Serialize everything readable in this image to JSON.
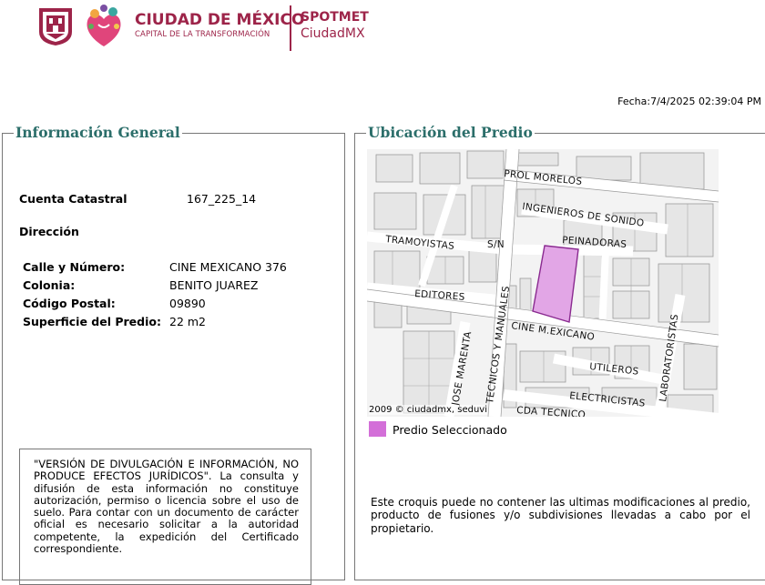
{
  "header": {
    "brand_title": "CIUDAD DE MÉXICO",
    "brand_subtitle": "CAPITAL DE LA TRANSFORMACIÓN",
    "app_line1": "SPOTMET",
    "app_line2": "CiudadMX",
    "brand_color": "#9d2449"
  },
  "fecha": "Fecha:7/4/2025 02:39:04 PM",
  "general": {
    "legend": "Información General",
    "cuenta_label": "Cuenta Catastral",
    "cuenta_value": "167_225_14",
    "direccion_label": "Dirección",
    "calle_label": "Calle y Número:",
    "calle_value": "CINE MEXICANO 376",
    "colonia_label": "Colonia:",
    "colonia_value": "BENITO JUAREZ",
    "cp_label": "Código Postal:",
    "cp_value": "09890",
    "superficie_label": "Superficie del Predio:",
    "superficie_value": "22 m2",
    "disclaimer": "\"VERSIÓN DE DIVULGACIÓN E INFORMACIÓN, NO PRODUCE EFECTOS JURÍDICOS\". La consulta y difusión de esta información no constituye autorización, permiso o licencia sobre el uso de suelo. Para contar con un documento de carácter oficial es necesario solicitar a la autoridad competente, la expedición del Certificado correspondiente."
  },
  "ubicacion": {
    "legend": "Ubicación del Predio",
    "streets": {
      "prol_morelos": "PROL MORELOS",
      "ingenieros": "INGENIEROS DE SONIDO",
      "peinadoras": "PEINADORAS",
      "tramoyistas": "TRAMOYISTAS",
      "sn": "S/N",
      "editores": "EDITORES",
      "tecnicos": "TECNICOS Y MANUALES",
      "cine_mexicano": "CINE M.EXICANO",
      "jose_marenta": "JOSE MARENTA",
      "utileros": "UTILEROS",
      "laboratoristas": "LABORATORISTAS",
      "electricistas": "ELECTRICISTAS",
      "cda_tecnicos": "CDA TECNICO"
    },
    "map_copyright": "2009 © ciudadmx, seduvi",
    "legend_label": "Predio Seleccionado",
    "selected_color": "#d36fd8",
    "note": "Este croquis puede no contener las ultimas modificaciones al predio, producto de fusiones y/o subdivisiones llevadas a cabo por el propietario."
  }
}
